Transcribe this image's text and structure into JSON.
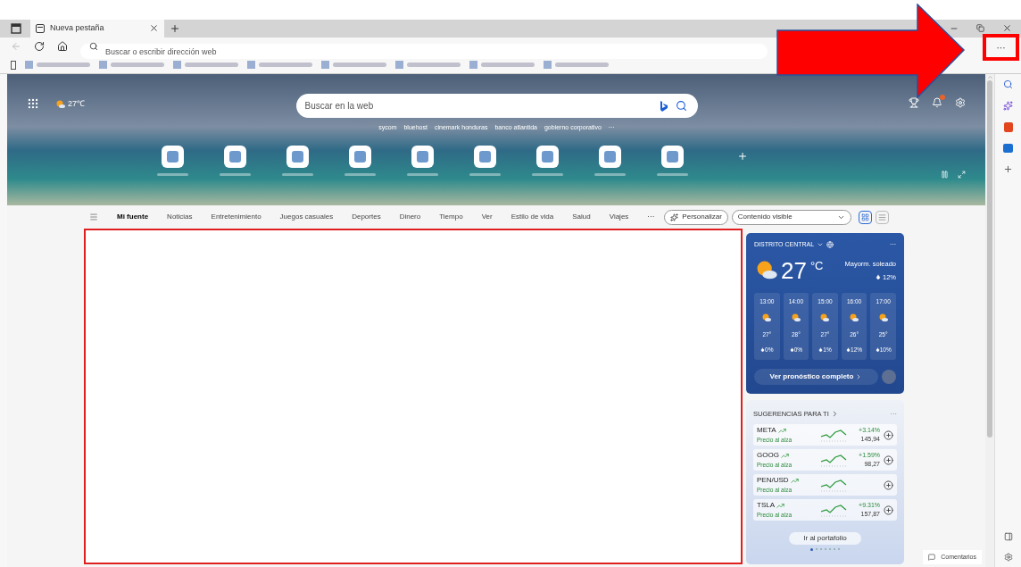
{
  "tabs": [
    {
      "title": "Nueva pestaña",
      "selected": true
    }
  ],
  "address_bar": {
    "placeholder": "Buscar o escribir dirección web"
  },
  "more_menu": "···",
  "banner": {
    "weather": "27℃",
    "search": {
      "placeholder": "Buscar en la web"
    },
    "trending": [
      "sycom",
      "bluehost",
      "cinemark honduras",
      "banco atlantida",
      "gobierno corporativo"
    ],
    "trending_more": "···"
  },
  "nav": {
    "items": [
      {
        "label": "Mi fuente",
        "selected": true
      },
      {
        "label": "Noticias",
        "selected": false
      },
      {
        "label": "Entretenimiento",
        "selected": false
      },
      {
        "label": "Juegos casuales",
        "selected": false
      },
      {
        "label": "Deportes",
        "selected": false
      },
      {
        "label": "Dinero",
        "selected": false
      },
      {
        "label": "Tiempo",
        "selected": false
      },
      {
        "label": "Ver",
        "selected": false
      },
      {
        "label": "Estilo de vida",
        "selected": false
      },
      {
        "label": "Salud",
        "selected": false
      },
      {
        "label": "Viajes",
        "selected": false
      }
    ],
    "more": "···",
    "personalize": "Personalizar",
    "visibility": "Contenido visible"
  },
  "weather": {
    "location": "DISTRITO CENTRAL",
    "temp": "27",
    "unit": "°C",
    "condition": "Mayorm. soleado",
    "precip": "12%",
    "more": "···",
    "hours": [
      {
        "time": "13:00",
        "temp": "27°",
        "precip": "0%"
      },
      {
        "time": "14:00",
        "temp": "28°",
        "precip": "0%"
      },
      {
        "time": "15:00",
        "temp": "27°",
        "precip": "1%"
      },
      {
        "time": "16:00",
        "temp": "26°",
        "precip": "12%"
      },
      {
        "time": "17:00",
        "temp": "25°",
        "precip": "10%"
      }
    ],
    "button": "Ver pronóstico completo"
  },
  "stocks": {
    "title": "SUGERENCIAS PARA TI",
    "more": "···",
    "items": [
      {
        "symbol": "META",
        "status": "Precio al alza",
        "change": "+3.14%",
        "price": "145,94"
      },
      {
        "symbol": "GOOG",
        "status": "Precio al alza",
        "change": "+1.59%",
        "price": "98,27"
      },
      {
        "symbol": "PEN/USD",
        "status": "Precio al alza"
      },
      {
        "symbol": "TSLA",
        "status": "Precio al alza",
        "change": "+9.31%",
        "price": "157,87"
      }
    ],
    "button": "Ir al portafolio",
    "pages": [
      {
        "selected": true
      },
      {
        "selected": false
      },
      {
        "selected": false
      },
      {
        "selected": false
      },
      {
        "selected": false
      },
      {
        "selected": false
      },
      {
        "selected": false
      }
    ]
  },
  "feedback": "Comentarios"
}
